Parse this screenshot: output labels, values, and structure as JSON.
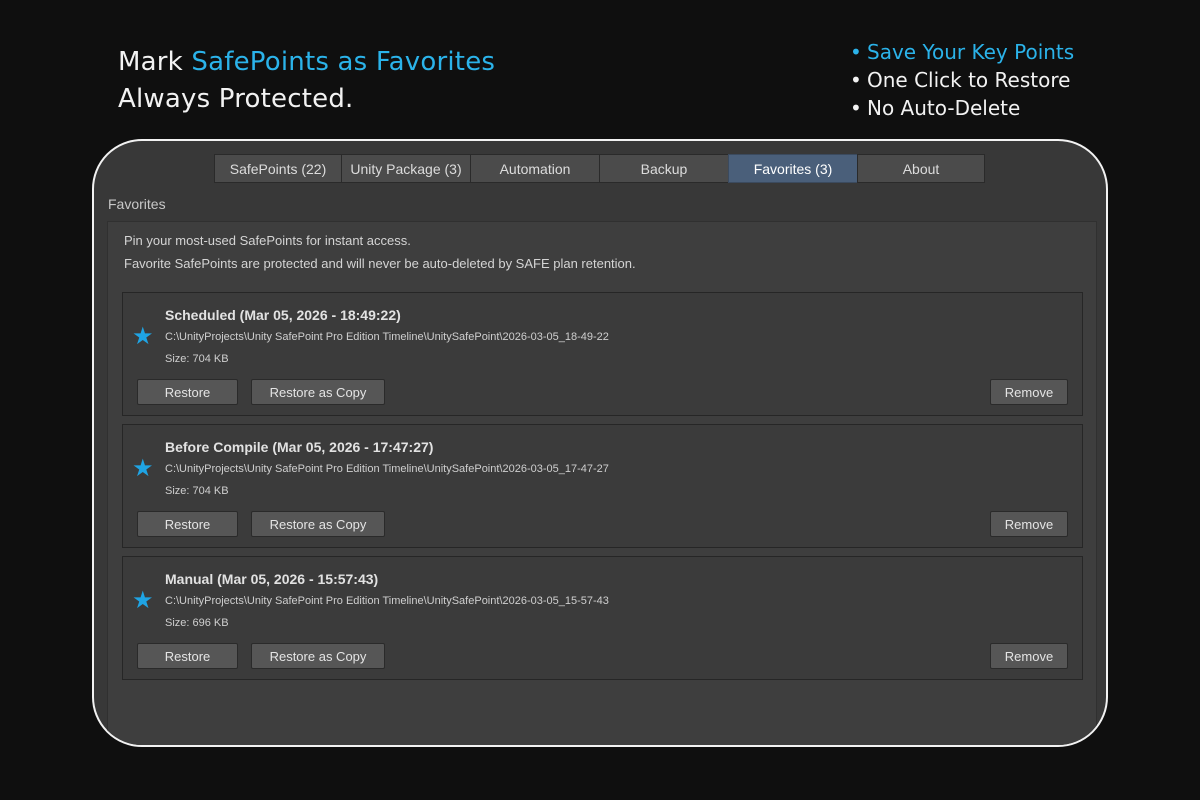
{
  "marketing": {
    "headline_prefix": "Mark ",
    "headline_accent": "SafePoints as Favorites",
    "headline_line2": "Always Protected.",
    "bullets": [
      "Save Your Key Points",
      "One Click to Restore",
      "No Auto-Delete"
    ],
    "bullet_glyph": "•"
  },
  "colors": {
    "accent": "#2bb3ea",
    "star": "#1fa4e4",
    "active_tab": "#4a5f7a"
  },
  "tabs": [
    {
      "label": "SafePoints (22)",
      "active": false
    },
    {
      "label": "Unity Package (3)",
      "active": false
    },
    {
      "label": "Automation",
      "active": false
    },
    {
      "label": "Backup",
      "active": false
    },
    {
      "label": "Favorites (3)",
      "active": true
    },
    {
      "label": "About",
      "active": false
    }
  ],
  "section_label": "Favorites",
  "description": {
    "line1": "Pin your most-used SafePoints for instant access.",
    "line2": "Favorite SafePoints are protected and will never be auto-deleted by SAFE plan retention."
  },
  "favorites": [
    {
      "title": "Scheduled (Mar 05, 2026 - 18:49:22)",
      "path": "C:\\UnityProjects\\Unity SafePoint Pro Edition Timeline\\UnitySafePoint\\2026-03-05_18-49-22",
      "size": "Size: 704 KB",
      "icon": "star-icon"
    },
    {
      "title": "Before Compile (Mar 05, 2026 - 17:47:27)",
      "path": "C:\\UnityProjects\\Unity SafePoint Pro Edition Timeline\\UnitySafePoint\\2026-03-05_17-47-27",
      "size": "Size: 704 KB",
      "icon": "star-icon"
    },
    {
      "title": "Manual (Mar 05, 2026 - 15:57:43)",
      "path": "C:\\UnityProjects\\Unity SafePoint Pro Edition Timeline\\UnitySafePoint\\2026-03-05_15-57-43",
      "size": "Size: 696 KB",
      "icon": "star-icon"
    }
  ],
  "buttons": {
    "restore": "Restore",
    "restore_copy": "Restore as Copy",
    "remove": "Remove"
  },
  "star_glyph": "★"
}
